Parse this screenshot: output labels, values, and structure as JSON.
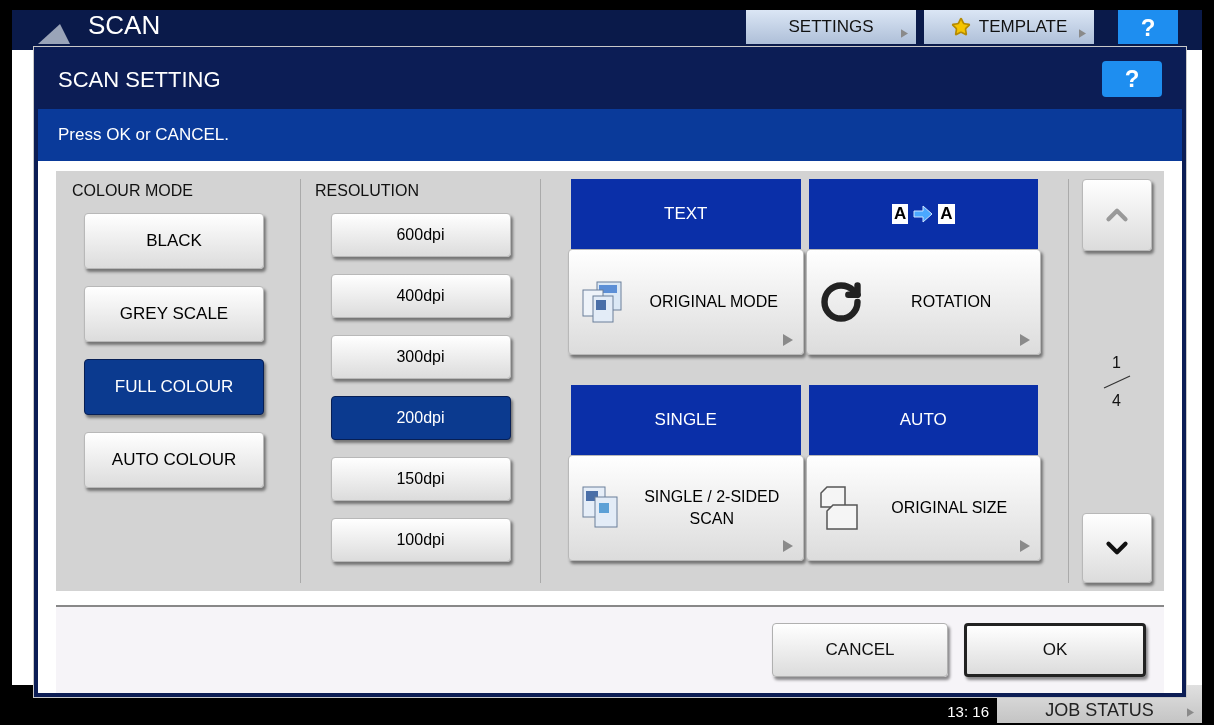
{
  "screen": {
    "title": "SCAN",
    "tabs": [
      {
        "label": "SETTINGS"
      },
      {
        "label": "TEMPLATE"
      }
    ],
    "help": "?"
  },
  "dialog": {
    "title": "SCAN SETTING",
    "help": "?",
    "message": "Press OK or CANCEL.",
    "colour_mode": {
      "label": "COLOUR MODE",
      "options": [
        {
          "label": "BLACK",
          "selected": false
        },
        {
          "label": "GREY SCALE",
          "selected": false
        },
        {
          "label": "FULL COLOUR",
          "selected": true
        },
        {
          "label": "AUTO COLOUR",
          "selected": false
        }
      ]
    },
    "resolution": {
      "label": "RESOLUTION",
      "options": [
        {
          "label": "600dpi",
          "selected": false
        },
        {
          "label": "400dpi",
          "selected": false
        },
        {
          "label": "300dpi",
          "selected": false
        },
        {
          "label": "200dpi",
          "selected": true
        },
        {
          "label": "150dpi",
          "selected": false
        },
        {
          "label": "100dpi",
          "selected": false
        }
      ]
    },
    "functions": [
      {
        "kind": "text",
        "value": "TEXT",
        "label": "ORIGINAL MODE"
      },
      {
        "kind": "rotation",
        "from": "A",
        "to": "A",
        "label": "ROTATION"
      },
      {
        "kind": "text",
        "value": "SINGLE",
        "label": "SINGLE / 2-SIDED SCAN"
      },
      {
        "kind": "text",
        "value": "AUTO",
        "label": "ORIGINAL SIZE"
      }
    ],
    "page": {
      "current": "1",
      "total": "4"
    },
    "buttons": [
      {
        "label": "CANCEL",
        "default": false
      },
      {
        "label": "OK",
        "default": true
      }
    ]
  },
  "status_bar": {
    "time": "13: 16",
    "job_status": "JOB STATUS"
  }
}
